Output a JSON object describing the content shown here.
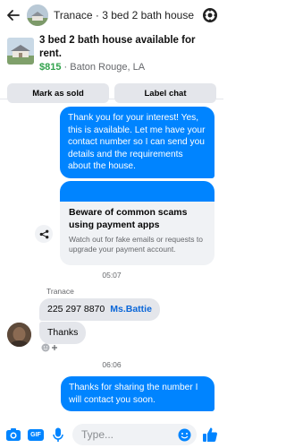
{
  "header": {
    "title": "Tranace · 3 bed 2 bath house"
  },
  "listing": {
    "title": "3 bed 2 bath house available for rent.",
    "price": "$815",
    "location_text": " · Baton Rouge, LA",
    "mark_sold_label": "Mark as sold",
    "label_chat_label": "Label chat"
  },
  "messages": {
    "outgoing_1": "Thank you for your interest! Yes, this is available. Let me have your contact number so I can send you details and the requirements about the house.",
    "link_card": {
      "title": "Beware of common scams using payment apps",
      "description": "Watch out for fake emails or requests to upgrade your payment account."
    },
    "timestamp_1": "05:07",
    "sender_name": "Tranace",
    "incoming_1_number": "225 297 8870",
    "incoming_1_mention": "Ms.Battie",
    "incoming_2": "Thanks",
    "timestamp_2": "06:06",
    "outgoing_2": "Thanks for sharing the number I will contact you soon."
  },
  "composer": {
    "gif_label": "GIF",
    "placeholder": "Type..."
  },
  "colors": {
    "accent": "#0084ff",
    "price": "#31a24c",
    "bubble_in": "#e4e6eb"
  },
  "icons": [
    "back-arrow-icon",
    "gear-icon",
    "share-icon",
    "camera-icon",
    "gif-icon",
    "microphone-icon",
    "emoji-icon",
    "thumbs-up-icon",
    "add-reaction-icon"
  ]
}
